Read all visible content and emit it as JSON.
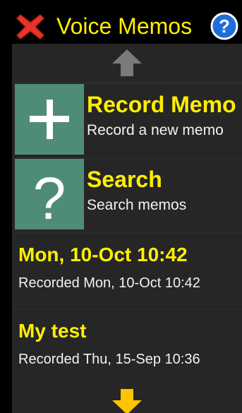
{
  "header": {
    "title": "Voice Memos",
    "close_icon": "close-icon",
    "help_icon": "help-icon"
  },
  "nav": {
    "up_icon": "arrow-up-icon",
    "down_icon": "arrow-down-icon"
  },
  "actions": [
    {
      "title": "Record Memo",
      "subtitle": "Record a new memo",
      "icon": "plus-icon"
    },
    {
      "title": "Search",
      "subtitle": "Search memos",
      "icon": "question-mark-icon"
    }
  ],
  "memos": [
    {
      "title": "Mon, 10-Oct 10:42",
      "subtitle": "Recorded Mon, 10-Oct 10:42"
    },
    {
      "title": "My test",
      "subtitle": "Recorded Thu, 15-Sep 10:36"
    }
  ],
  "colors": {
    "accent": "#ffef00",
    "tile": "#4f8b79",
    "row_background": "#262626",
    "close_red": "#e8352b",
    "help_blue": "#1e6fd9"
  }
}
